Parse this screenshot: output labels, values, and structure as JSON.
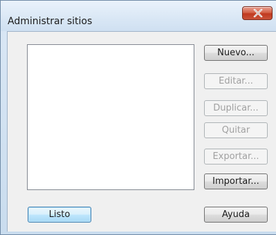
{
  "window": {
    "title": "Administrar sitios",
    "close_glyph": "✕"
  },
  "sites_list": {
    "items": []
  },
  "buttons": {
    "new": "Nuevo...",
    "edit": "Editar...",
    "duplicate": "Duplicar...",
    "remove": "Quitar",
    "export": "Exportar...",
    "import": "Importar...",
    "done": "Listo",
    "help": "Ayuda"
  },
  "colors": {
    "close_button": "#c9533a",
    "default_button_border": "#3c7fb1",
    "disabled_text": "#a0a0a0"
  },
  "icons": {
    "close": "close-icon"
  }
}
